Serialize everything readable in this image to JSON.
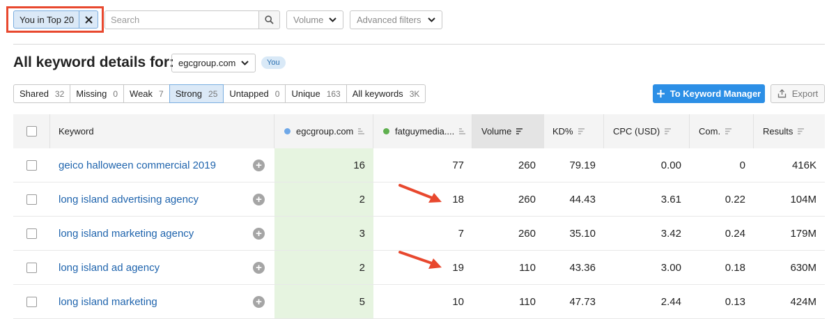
{
  "filters": {
    "active_chip_label": "You in Top 20",
    "search_placeholder": "Search",
    "volume_label": "Volume",
    "advanced_label": "Advanced filters"
  },
  "heading": {
    "title": "All keyword details for:",
    "domain": "egcgroup.com",
    "you_badge": "You"
  },
  "tabs": [
    {
      "label": "Shared",
      "count": "32"
    },
    {
      "label": "Missing",
      "count": "0"
    },
    {
      "label": "Weak",
      "count": "7"
    },
    {
      "label": "Strong",
      "count": "25",
      "active": true
    },
    {
      "label": "Untapped",
      "count": "0"
    },
    {
      "label": "Unique",
      "count": "163"
    },
    {
      "label": "All keywords",
      "count": "3K"
    }
  ],
  "actions": {
    "keyword_manager": "To Keyword Manager",
    "export": "Export"
  },
  "colors": {
    "accent_blue": "#2c8fe6",
    "egc_dot": "#6fa8e8",
    "fatguy_dot": "#5fb04f",
    "highlight_red": "#e8482e",
    "you_column_bg": "#e6f4e0"
  },
  "table": {
    "headers": {
      "keyword": "Keyword",
      "domain1": "egcgroup.com",
      "domain2": "fatguymedia....",
      "volume": "Volume",
      "kd": "KD%",
      "cpc": "CPC (USD)",
      "com": "Com.",
      "results": "Results"
    },
    "rows": [
      {
        "keyword": "geico halloween commercial 2019",
        "d1": "16",
        "d2": "77",
        "volume": "260",
        "kd": "79.19",
        "cpc": "0.00",
        "com": "0",
        "results": "416K"
      },
      {
        "keyword": "long island advertising agency",
        "d1": "2",
        "d2": "18",
        "volume": "260",
        "kd": "44.43",
        "cpc": "3.61",
        "com": "0.22",
        "results": "104M"
      },
      {
        "keyword": "long island marketing agency",
        "d1": "3",
        "d2": "7",
        "volume": "260",
        "kd": "35.10",
        "cpc": "3.42",
        "com": "0.24",
        "results": "179M"
      },
      {
        "keyword": "long island ad agency",
        "d1": "2",
        "d2": "19",
        "volume": "110",
        "kd": "43.36",
        "cpc": "3.00",
        "com": "0.18",
        "results": "630M"
      },
      {
        "keyword": "long island marketing",
        "d1": "5",
        "d2": "10",
        "volume": "110",
        "kd": "47.73",
        "cpc": "2.44",
        "com": "0.13",
        "results": "424M"
      }
    ]
  }
}
